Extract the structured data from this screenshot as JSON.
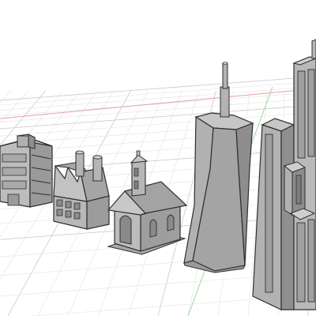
{
  "viewport": {
    "background": "#ffffff",
    "grid": {
      "minor_color": "#e3e3e3",
      "major_color": "#cfcfcf",
      "x_axis_color": "#e8a0a0",
      "y_axis_color": "#9fd69f"
    }
  },
  "model": {
    "fill_light": "#b9b9b9",
    "fill_mid": "#9c9c9c",
    "fill_dark": "#7d7d7d",
    "edge_color": "#2f2f2f",
    "buildings": [
      {
        "name": "office-building"
      },
      {
        "name": "factory"
      },
      {
        "name": "chapel"
      },
      {
        "name": "twisted-tower"
      },
      {
        "name": "skyscraper"
      }
    ]
  }
}
